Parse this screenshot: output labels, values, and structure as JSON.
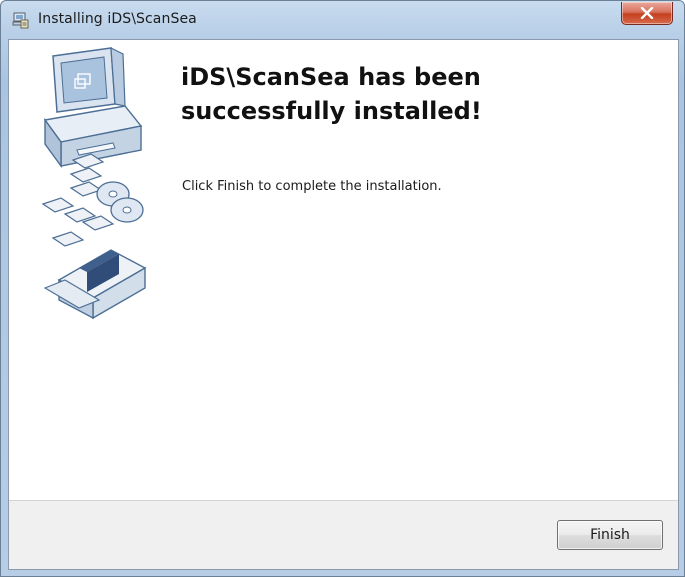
{
  "window": {
    "title": "Installing iDS\\ScanSea",
    "app_icon": "installer-icon",
    "close_icon": "close-icon"
  },
  "content": {
    "heading": "iDS\\ScanSea has been successfully installed!",
    "message": "Click Finish to complete the installation.",
    "illustration": "computer-and-disks-illustration"
  },
  "footer": {
    "finish_label": "Finish"
  },
  "colors": {
    "titlebar": "#b9d0e8",
    "close_button": "#c4401f",
    "footer": "#f0f0f0"
  }
}
